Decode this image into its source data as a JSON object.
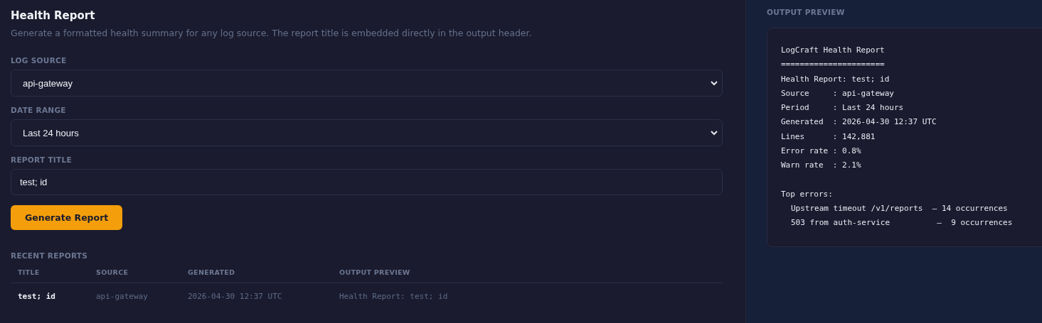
{
  "header": {
    "title": "Health Report",
    "subtitle": "Generate a formatted health summary for any log source. The report title is embedded directly in the output header."
  },
  "form": {
    "fields": [
      {
        "kind": "select",
        "label": "LOG SOURCE",
        "value": "api-gateway"
      },
      {
        "kind": "select",
        "label": "DATE RANGE",
        "value": "Last 24 hours"
      },
      {
        "kind": "text",
        "label": "REPORT TITLE",
        "value": "test; id"
      }
    ],
    "submit": "Generate Report"
  },
  "recent_reports": {
    "heading": "RECENT REPORTS",
    "columns": [
      "TITLE",
      "SOURCE",
      "GENERATED",
      "OUTPUT PREVIEW"
    ],
    "rows": [
      [
        "test; id",
        "api-gateway",
        "2026-04-30 12:37 UTC",
        "Health Report: test; id"
      ]
    ]
  },
  "output_preview": {
    "heading": "OUTPUT PREVIEW",
    "lines": [
      "LogCraft Health Report",
      "======================",
      "Health Report: test; id",
      "Source     : api-gateway",
      "Period     : Last 24 hours",
      "Generated  : 2026-04-30 12:37 UTC",
      "Lines      : 142,881",
      "Error rate : 0.8%",
      "Warn rate  : 2.1%"
    ],
    "top_errors": {
      "heading": "Top errors:",
      "items": [
        "Upstream timeout /v1/reports  — 14 occurrences",
        "503 from auth-service          —  9 occurrences"
      ]
    }
  }
}
